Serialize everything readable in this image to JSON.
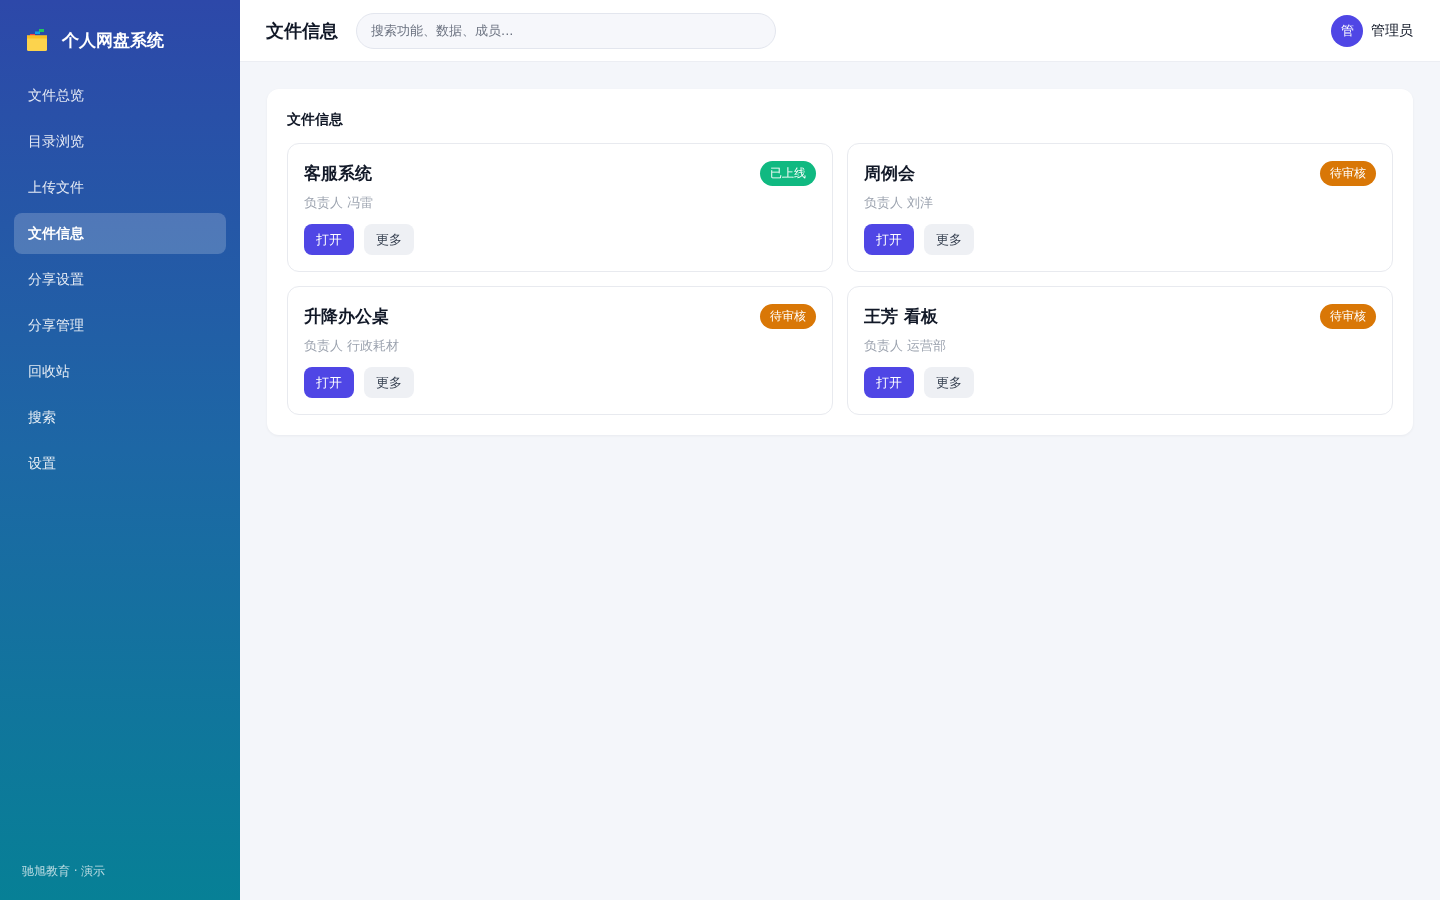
{
  "sidebar": {
    "brand": "个人网盘系统",
    "items": [
      {
        "label": "文件总览",
        "selected": false
      },
      {
        "label": "目录浏览",
        "selected": false
      },
      {
        "label": "上传文件",
        "selected": false
      },
      {
        "label": "文件信息",
        "selected": true
      },
      {
        "label": "分享设置",
        "selected": false
      },
      {
        "label": "分享管理",
        "selected": false
      },
      {
        "label": "回收站",
        "selected": false
      },
      {
        "label": "搜索",
        "selected": false
      },
      {
        "label": "设置",
        "selected": false
      }
    ],
    "footer": "驰旭教育 · 演示"
  },
  "header": {
    "title": "文件信息",
    "search": {
      "placeholder": "搜索功能、数据、成员..."
    },
    "user": {
      "avatar": "管",
      "name": "管理员"
    }
  },
  "panel": {
    "title": "文件信息",
    "cards": [
      {
        "title": "客服系统",
        "status": {
          "label": "已上线",
          "color": "#10b981"
        },
        "owner": "负责人 冯雷",
        "buttons": [
          {
            "label": "打开",
            "kind": "primary"
          },
          {
            "label": "更多",
            "kind": "secondary"
          }
        ]
      },
      {
        "title": "周例会",
        "status": {
          "label": "待审核",
          "color": "#d97706"
        },
        "owner": "负责人 刘洋",
        "buttons": [
          {
            "label": "打开",
            "kind": "primary"
          },
          {
            "label": "更多",
            "kind": "secondary"
          }
        ]
      },
      {
        "title": "升降办公桌",
        "status": {
          "label": "待审核",
          "color": "#d97706"
        },
        "owner": "负责人 行政耗材",
        "buttons": [
          {
            "label": "打开",
            "kind": "primary"
          },
          {
            "label": "更多",
            "kind": "secondary"
          }
        ]
      },
      {
        "title": "王芳 看板",
        "status": {
          "label": "待审核",
          "color": "#d97706"
        },
        "owner": "负责人 运营部",
        "buttons": [
          {
            "label": "打开",
            "kind": "primary"
          },
          {
            "label": "更多",
            "kind": "secondary"
          }
        ]
      }
    ]
  }
}
